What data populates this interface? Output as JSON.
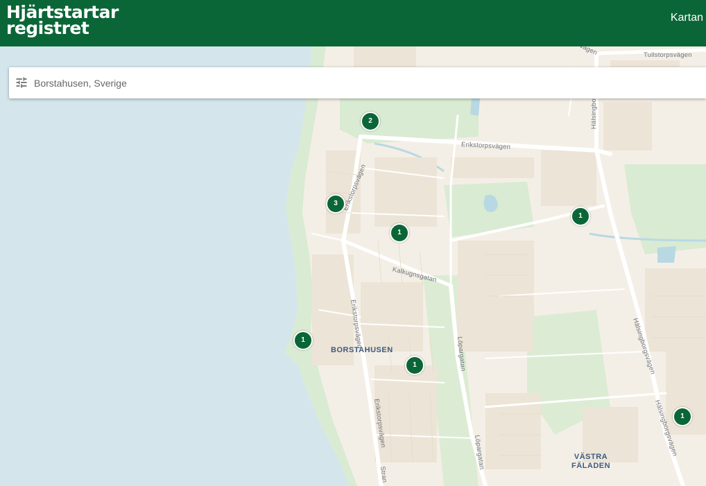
{
  "header": {
    "logo_line1": "Hjärtstartar",
    "logo_line2": "registret",
    "nav_link": "Kartan"
  },
  "search": {
    "value": "Borstahusen, Sverige",
    "filter_icon": "tune-icon"
  },
  "colors": {
    "brand": "#0b6637",
    "water": "#d4e6ec",
    "land": "#f4efe6",
    "park": "#d9ebd2",
    "road": "#ffffff"
  },
  "markers": [
    {
      "id": "marker-1",
      "count": "2"
    },
    {
      "id": "marker-2",
      "count": "3"
    },
    {
      "id": "marker-3",
      "count": "1"
    },
    {
      "id": "marker-4",
      "count": "1"
    },
    {
      "id": "marker-5",
      "count": "1"
    },
    {
      "id": "marker-6",
      "count": "1"
    },
    {
      "id": "marker-7",
      "count": "1"
    }
  ],
  "map_labels": {
    "tullstorpsvagen": "Tullstorpsvägen",
    "erikstorpsvagen_top": "Erikstorpsvägen",
    "erikstorpsvagen_diag": "Erikstorpsvägen",
    "erikstorpsvagen_mid": "Erikstorpsvägen",
    "erikstorpsvagen_low": "Erikstorpsvägen",
    "kalkugnsgatan": "Kalkugnsgatan",
    "lopargatan_1": "Löpargatan",
    "lopargatan_2": "Löpargatan",
    "halsingborgsvagen_1": "Hälsingborgsvägen",
    "halsingborgsvagen_2": "Hälsingborgsvägen",
    "halsingbor_top": "Hälsingbor",
    "vagen_top": "vägen",
    "stran": "Stran",
    "borstahusen": "BORSTAHUSEN",
    "vastra": "VÄSTRA",
    "faladen": "FÄLADEN"
  }
}
